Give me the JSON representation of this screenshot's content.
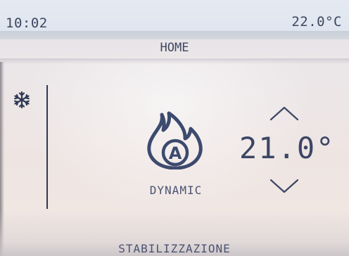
{
  "status_bar": {
    "time": "10:02",
    "external_temperature": "22.0°C"
  },
  "header": {
    "title": "HOME"
  },
  "mode": {
    "icon": "snowflake-icon"
  },
  "program": {
    "icon": "flame-auto-icon",
    "icon_letter": "A",
    "label": "DYNAMIC"
  },
  "setpoint": {
    "value": "21.0°",
    "up_icon": "chevron-up-icon",
    "down_icon": "chevron-down-icon"
  },
  "footer": {
    "status": "STABILIZZAZIONE"
  },
  "colors": {
    "foreground": "#404a68",
    "background": "#ebe6e9",
    "status_bar": "#e2e7f0"
  }
}
